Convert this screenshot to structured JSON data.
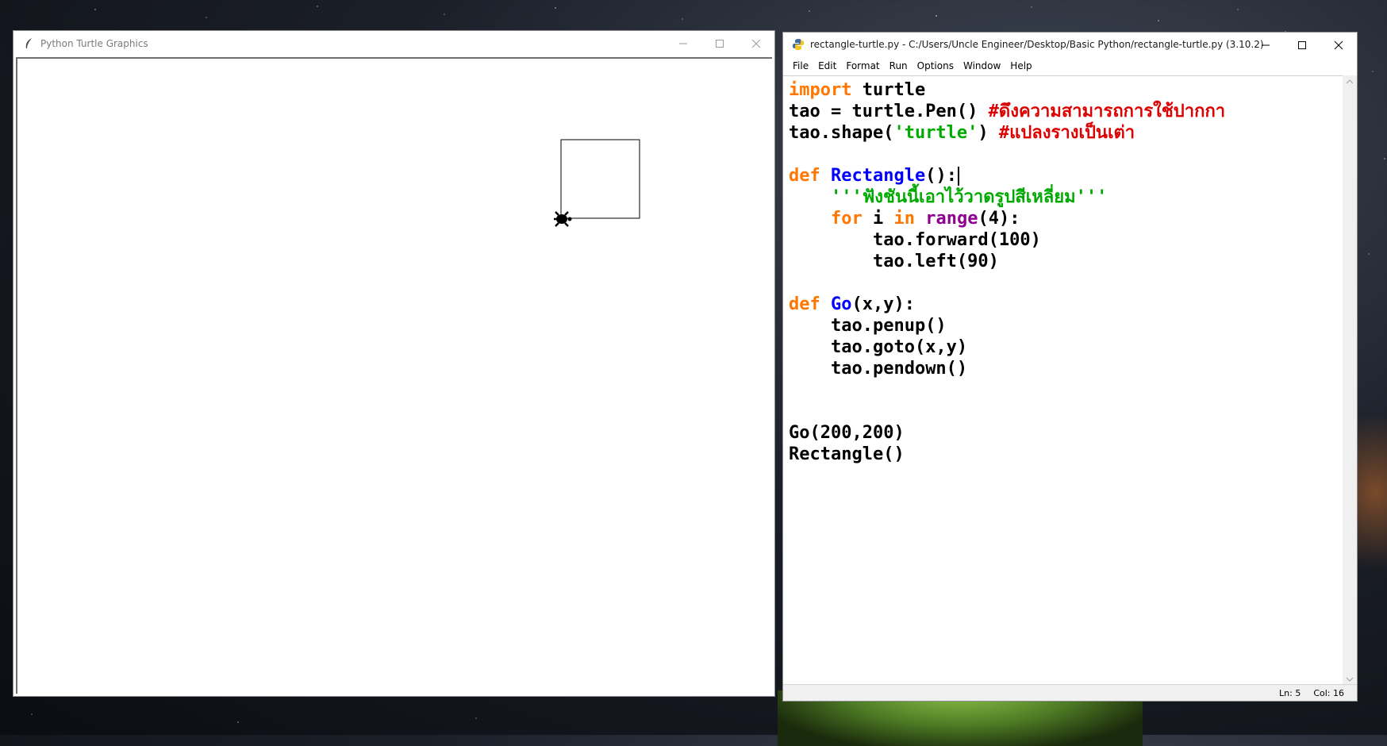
{
  "turtle_window": {
    "title": "Python Turtle Graphics",
    "icon": "feather-icon"
  },
  "idle_window": {
    "title": "rectangle-turtle.py - C:/Users/Uncle Engineer/Desktop/Basic Python/rectangle-turtle.py (3.10.2)",
    "icon": "python-icon",
    "menu": [
      "File",
      "Edit",
      "Format",
      "Run",
      "Options",
      "Window",
      "Help"
    ],
    "code": {
      "l1_kw": "import",
      "l1_rest": " turtle",
      "l2_code": "tao = turtle.Pen() ",
      "l2_comment": "#ดึงความสามารถการใช้ปากกา",
      "l3_a": "tao.shape(",
      "l3_str": "'turtle'",
      "l3_b": ") ",
      "l3_comment": "#แปลงรางเป็นเต่า",
      "l5_kw": "def",
      "l5_fn": "Rectangle",
      "l5_rest": "():",
      "l6_doc": "'''ฟังชันนี้เอาไว้วาดรูปสีเหลี่ยม'''",
      "l7_kw1": "for",
      "l7_mid": " i ",
      "l7_kw2": "in",
      "l7_bi": "range",
      "l7_rest": "(4):",
      "l8": "tao.forward(100)",
      "l9": "tao.left(90)",
      "l11_kw": "def",
      "l11_fn": "Go",
      "l11_rest": "(x,y):",
      "l12": "tao.penup()",
      "l13": "tao.goto(x,y)",
      "l14": "tao.pendown()",
      "l17": "Go(200,200)",
      "l18": "Rectangle()"
    },
    "status": {
      "line": "Ln: 5",
      "col": "Col: 16"
    }
  },
  "colors": {
    "keyword": "#ff7700",
    "definition": "#0000ff",
    "string": "#00aa00",
    "comment": "#dd0000",
    "builtin": "#900090"
  }
}
